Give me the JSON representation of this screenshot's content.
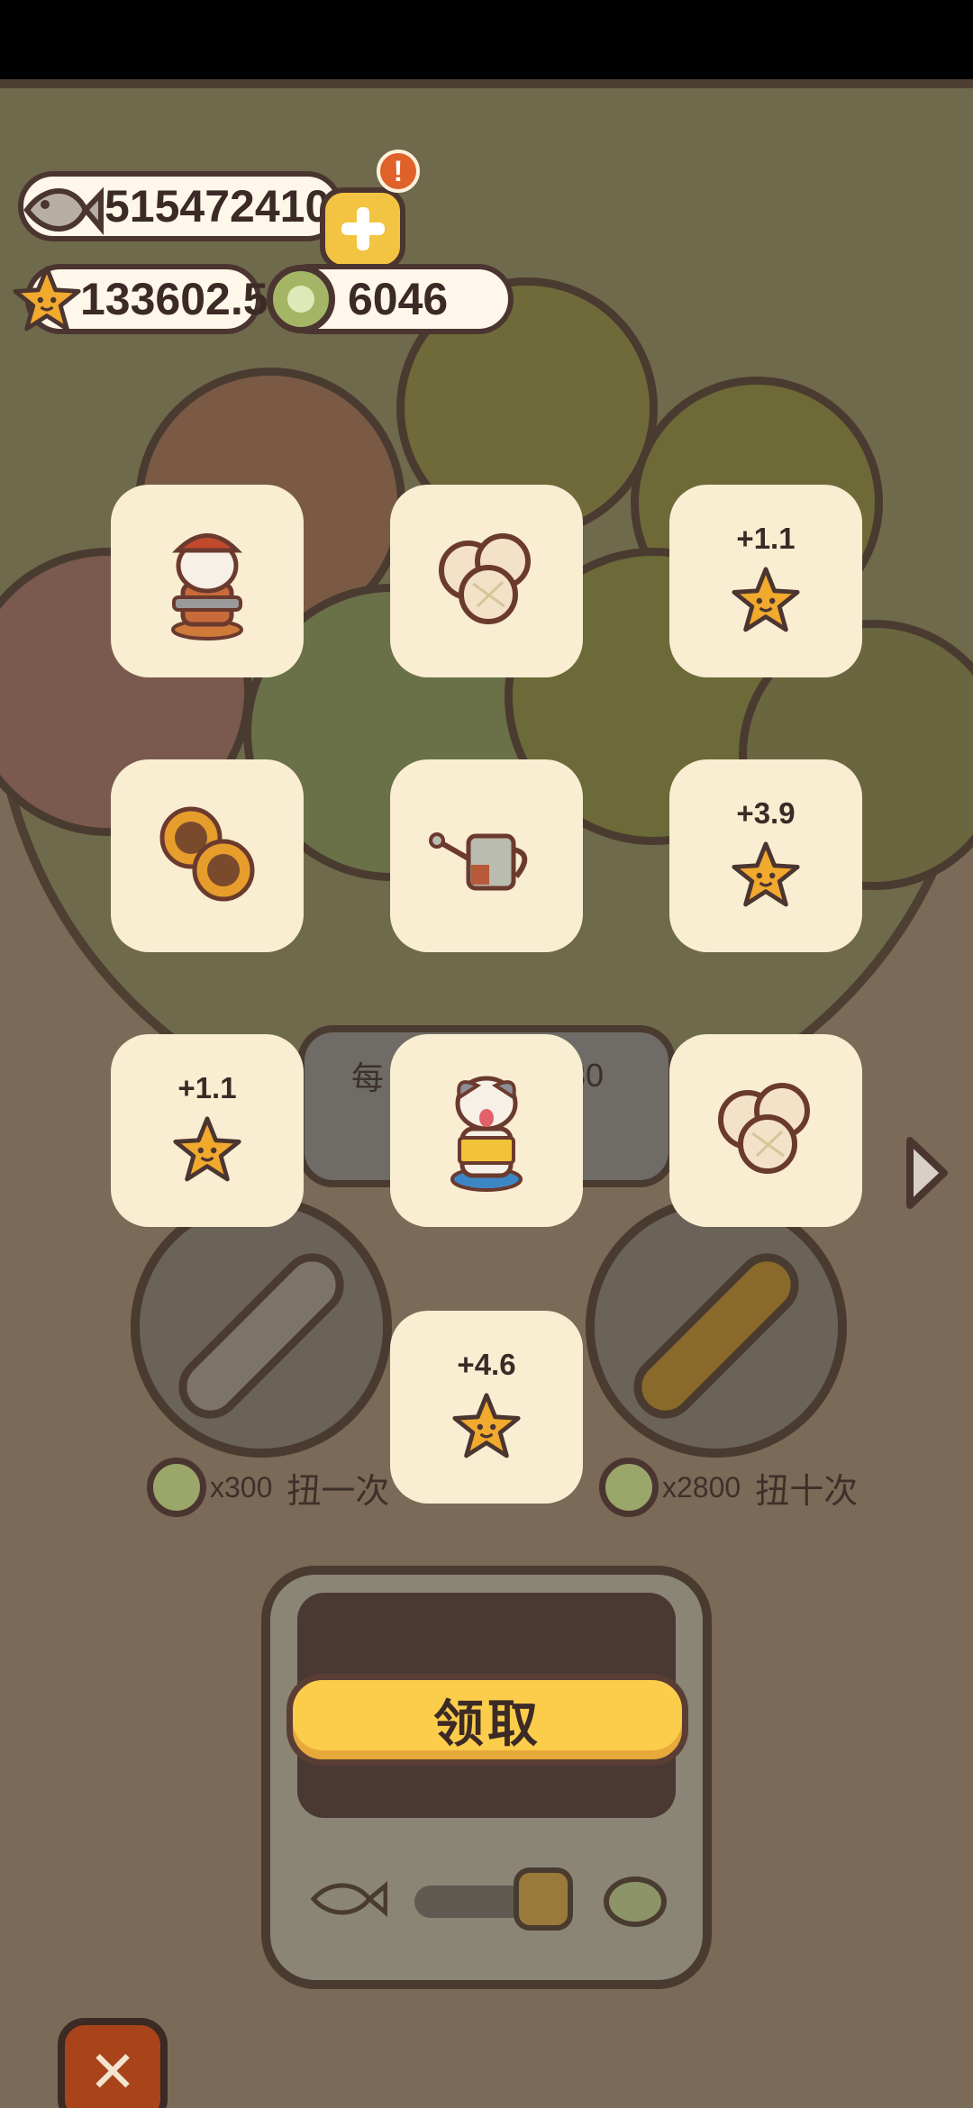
{
  "currencies": {
    "fish": "515472410",
    "star": "133602.5",
    "coin": "6046",
    "alert_mark": "!"
  },
  "rewards": [
    {
      "kind": "character-miner",
      "amount": ""
    },
    {
      "kind": "melon-bread",
      "amount": ""
    },
    {
      "kind": "star",
      "amount": "+1.1"
    },
    {
      "kind": "sunflower",
      "amount": ""
    },
    {
      "kind": "watering-can",
      "amount": ""
    },
    {
      "kind": "star",
      "amount": "+3.9"
    },
    {
      "kind": "star",
      "amount": "+1.1"
    },
    {
      "kind": "character-dog-reader",
      "amount": ""
    },
    {
      "kind": "melon-bread",
      "amount": ""
    },
    {
      "kind": "star",
      "amount": "+4.6"
    }
  ],
  "machine": {
    "partial_left": "每",
    "partial_right": "30",
    "spin_one_cost": "x300",
    "spin_one_label": "扭一次",
    "spin_ten_cost": "x2800",
    "spin_ten_label": "扭十次"
  },
  "claim_button": "领取",
  "close_button": "✕",
  "colors": {
    "tile": "#f9edd2",
    "claim": "#fbcd4a",
    "close": "#a8431a",
    "star": "#f1a92e",
    "outline": "#4b3530"
  }
}
